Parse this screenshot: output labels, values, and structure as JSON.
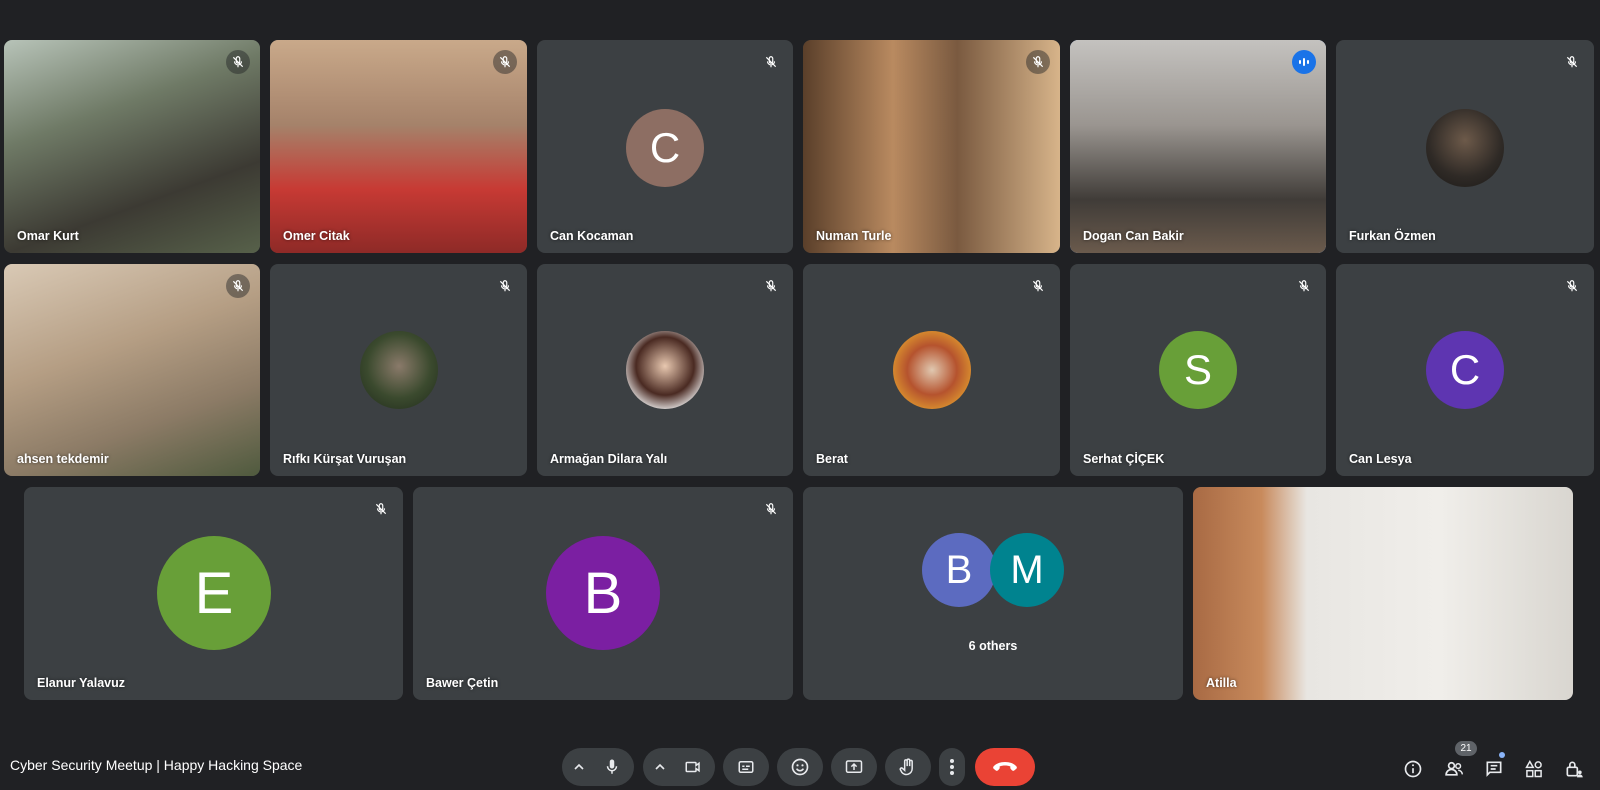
{
  "participants": {
    "omar_kurt": {
      "name": "Omar Kurt"
    },
    "omer_citak": {
      "name": "Omer Citak"
    },
    "can_kocaman": {
      "name": "Can Kocaman",
      "initial": "C",
      "avatar_color": "#8d6e63"
    },
    "numan_turle": {
      "name": "Numan Turle"
    },
    "dogan_can_bakir": {
      "name": "Dogan Can Bakir"
    },
    "furkan_ozmen": {
      "name": "Furkan Özmen"
    },
    "ahsen_tekdemir": {
      "name": "ahsen tekdemir"
    },
    "rifki_kursat_vurusan": {
      "name": "Rıfkı Kürşat Vuruşan"
    },
    "armagan_dilara_yali": {
      "name": "Armağan Dilara Yalı"
    },
    "berat": {
      "name": "Berat"
    },
    "serhat_cicek": {
      "name": "Serhat ÇİÇEK",
      "initial": "S",
      "avatar_color": "#689f38"
    },
    "can_lesya": {
      "name": "Can Lesya",
      "initial": "C",
      "avatar_color": "#5e35b1"
    },
    "elanur_yalavuz": {
      "name": "Elanur Yalavuz",
      "initial": "E",
      "avatar_color": "#689f38"
    },
    "bawer_cetin": {
      "name": "Bawer Çetin",
      "initial": "B",
      "avatar_color": "#7b1fa2"
    },
    "others": {
      "label": "6 others",
      "initials": [
        "B",
        "M"
      ],
      "avatar_colors": [
        "#5c6bc0",
        "#00838f"
      ]
    },
    "atilla": {
      "name": "Atilla"
    }
  },
  "meeting": {
    "title": "Cyber Security Meetup | Happy Hacking Space"
  },
  "toolbar": {
    "people_count": "21",
    "end_call_color": "#ea4335",
    "speaking_color": "#8ab4f8"
  }
}
